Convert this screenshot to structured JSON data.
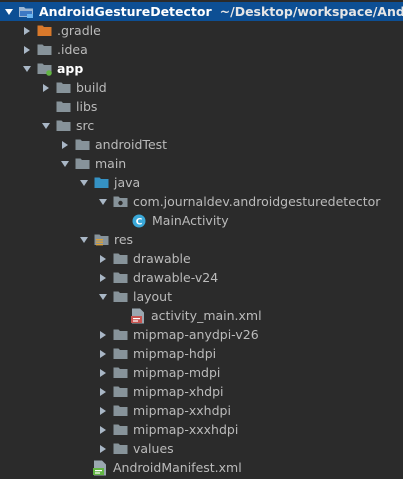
{
  "project": {
    "name": "AndroidGestureDetector",
    "path": "~/Desktop/workspace/AndroidG"
  },
  "nodes": [
    {
      "label": ".gradle",
      "icon": "folder-orange-icon"
    },
    {
      "label": ".idea",
      "icon": "folder-icon"
    },
    {
      "label": "app",
      "icon": "module-folder-icon"
    },
    {
      "label": "build",
      "icon": "folder-icon"
    },
    {
      "label": "libs",
      "icon": "folder-icon"
    },
    {
      "label": "src",
      "icon": "folder-icon"
    },
    {
      "label": "androidTest",
      "icon": "folder-icon"
    },
    {
      "label": "main",
      "icon": "folder-icon"
    },
    {
      "label": "java",
      "icon": "source-folder-icon"
    },
    {
      "label": "com.journaldev.androidgesturedetector",
      "icon": "package-icon"
    },
    {
      "label": "MainActivity",
      "icon": "class-icon"
    },
    {
      "label": "res",
      "icon": "resource-folder-icon"
    },
    {
      "label": "drawable",
      "icon": "folder-icon"
    },
    {
      "label": "drawable-v24",
      "icon": "folder-icon"
    },
    {
      "label": "layout",
      "icon": "folder-icon"
    },
    {
      "label": "activity_main.xml",
      "icon": "xml-layout-file-icon"
    },
    {
      "label": "mipmap-anydpi-v26",
      "icon": "folder-icon"
    },
    {
      "label": "mipmap-hdpi",
      "icon": "folder-icon"
    },
    {
      "label": "mipmap-mdpi",
      "icon": "folder-icon"
    },
    {
      "label": "mipmap-xhdpi",
      "icon": "folder-icon"
    },
    {
      "label": "mipmap-xxhdpi",
      "icon": "folder-icon"
    },
    {
      "label": "mipmap-xxxhdpi",
      "icon": "folder-icon"
    },
    {
      "label": "values",
      "icon": "folder-icon"
    },
    {
      "label": "AndroidManifest.xml",
      "icon": "manifest-file-icon"
    }
  ],
  "colors": {
    "background": "#2b2b2b",
    "selection": "#0d4f94",
    "folder": "#87939a",
    "folder_orange": "#d9792b",
    "source_folder": "#3592c4",
    "class_icon": "#3aa8d8",
    "xml_icon": "#c75450",
    "manifest_icon": "#62b543"
  }
}
